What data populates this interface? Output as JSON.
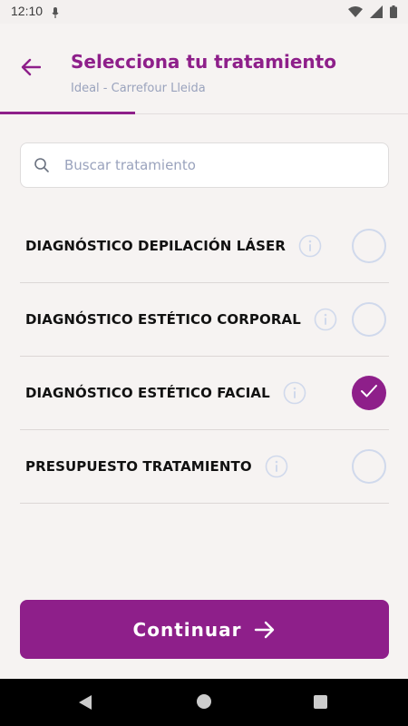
{
  "status_bar": {
    "time": "12:10",
    "icons": [
      "mic-icon",
      "wifi-icon",
      "signal-icon",
      "battery-icon"
    ]
  },
  "header": {
    "title": "Selecciona tu tratamiento",
    "subtitle": "Ideal - Carrefour Lleida",
    "back_icon": "arrow-left-icon",
    "progress_fraction": 0.33
  },
  "search": {
    "placeholder": "Buscar tratamiento",
    "value": "",
    "icon": "search-icon"
  },
  "treatments": [
    {
      "label": "DIAGNÓSTICO DEPILACIÓN LÁSER",
      "selected": false
    },
    {
      "label": "DIAGNÓSTICO ESTÉTICO CORPORAL",
      "selected": false
    },
    {
      "label": "DIAGNÓSTICO ESTÉTICO FACIAL",
      "selected": true
    },
    {
      "label": "PRESUPUESTO TRATAMIENTO",
      "selected": false
    }
  ],
  "continue_button": {
    "label": "Continuar",
    "icon": "arrow-right-icon"
  },
  "colors": {
    "primary": "#8e1f8a",
    "subtitle": "#9aa3bd",
    "background": "#f6f3f2",
    "radio_border": "#d0d9ec"
  }
}
